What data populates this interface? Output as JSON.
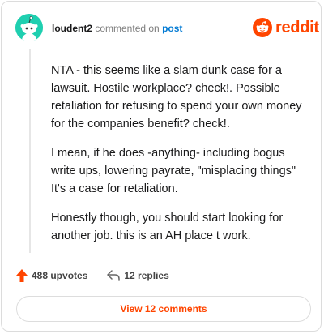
{
  "header": {
    "username": "loudent2",
    "action": "commented on",
    "link": "post"
  },
  "logo": {
    "text": "reddit",
    "icon": "reddit-alien-icon"
  },
  "comment": {
    "paragraphs": [
      "NTA - this seems like a slam dunk case for a lawsuit. Hostile workplace? check!. Possible retaliation for refusing to spend your own money for the companies benefit? check!.",
      "I mean, if he does -anything- including bogus write ups, lowering payrate, \"misplacing things\" It's a case for retaliation.",
      "Honestly though, you should start looking for another job. this is an AH place t work."
    ]
  },
  "stats": {
    "upvotes": "488 upvotes",
    "replies": "12 replies"
  },
  "footer": {
    "view_comments": "View 12 comments"
  },
  "colors": {
    "brand": "#ff4500",
    "avatar_bg": "#1fcfb0",
    "link": "#0079d3"
  }
}
